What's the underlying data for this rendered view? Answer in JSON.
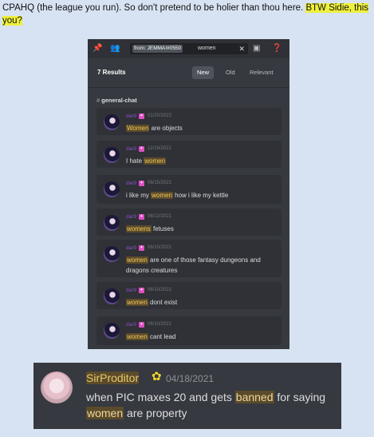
{
  "post": {
    "text_prefix": "CPAHQ (the league you run). So don't pretend to be holier than thou here.",
    "highlight": "BTW Sidie, this you?"
  },
  "search": {
    "chip": "from: JEMMA!#0550",
    "query": "women",
    "results_count": "7 Results",
    "sort_options": [
      "New",
      "Old",
      "Relevant"
    ],
    "active_sort": "New",
    "channel": "general-chat",
    "results": [
      {
        "user": "dar9",
        "date": "01/20/2022",
        "pre": "",
        "kw": "Women",
        "post": " are objects"
      },
      {
        "user": "dar9",
        "date": "12/19/2021",
        "pre": "I hate ",
        "kw": "women",
        "post": ""
      },
      {
        "user": "dar9",
        "date": "06/15/2021",
        "pre": "i like my ",
        "kw": "women",
        "post": " how i like my kettle"
      },
      {
        "user": "dar9",
        "date": "06/12/2021",
        "pre": "",
        "kw": "womens",
        "post": " fetuses"
      },
      {
        "user": "dar9",
        "date": "06/10/2021",
        "pre": "",
        "kw": "women",
        "post": " are one of those fantasy dungeons and dragons creatures"
      },
      {
        "user": "dar9",
        "date": "06/10/2021",
        "pre": "",
        "kw": "women",
        "post": " dont exist"
      },
      {
        "user": "dar9",
        "date": "06/10/2021",
        "pre": "",
        "kw": "women",
        "post": " cant lead"
      }
    ]
  },
  "message": {
    "username": "SirProditor",
    "date": "04/18/2021",
    "t1": "when PIC maxes 20 and gets ",
    "k1": "banned",
    "t2": " for saying ",
    "k2": "women",
    "t3": " are property"
  },
  "colors": {
    "page_bg": "#d7e3f2",
    "highlight": "#eef03c",
    "discord_bg": "#36393f",
    "keyword_bg": "#5b4b2a",
    "username": "#8a50c9"
  }
}
